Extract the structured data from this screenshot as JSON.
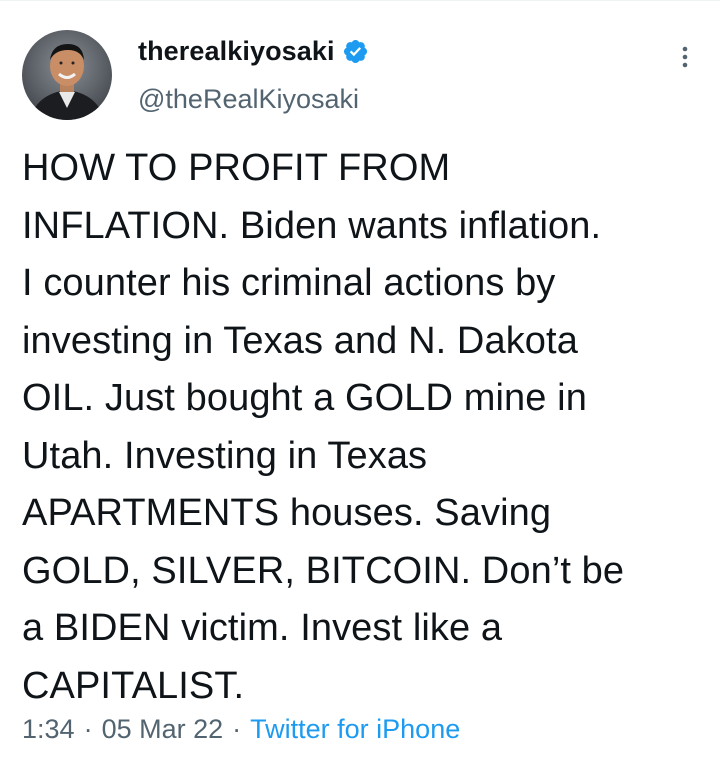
{
  "tweet": {
    "author": {
      "display_name": "therealkiyosaki",
      "handle": "@theRealKiyosaki",
      "verified": true,
      "avatar_icon": "profile-photo"
    },
    "text": "HOW TO PROFIT FROM\nINFLATION. Biden wants inflation.\nI counter his criminal actions by\ninvesting in Texas and N. Dakota\nOIL. Just bought a GOLD mine in\nUtah. Investing in Texas\nAPARTMENTS houses. Saving\nGOLD, SILVER, BITCOIN. Don’t be\na BIDEN victim. Invest like a\nCAPITALIST.",
    "time": "1:34",
    "date": "05 Mar 22",
    "separator": "·",
    "source": "Twitter for iPhone",
    "more_icon": "more-vertical-icon"
  },
  "colors": {
    "text_primary": "#0f1419",
    "text_secondary": "#536471",
    "accent": "#1d9bf0"
  }
}
